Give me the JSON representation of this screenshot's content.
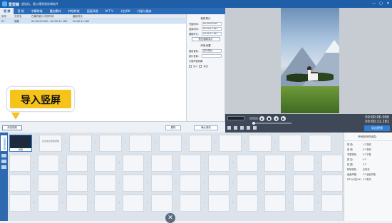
{
  "titlebar": {
    "app_name": "爱剪辑",
    "subtitle": "超轻松，最火爆视频剪辑软件",
    "buttons": [
      "—",
      "▢",
      "✕"
    ]
  },
  "menu": {
    "items": [
      "视 频",
      "音 频",
      "字幕特效",
      "叠加素材",
      "转场特效",
      "画面风格",
      "M T V",
      "卡拉OK",
      "升级与服务"
    ],
    "active_index": 0
  },
  "table": {
    "columns": [
      "序号",
      "文件名",
      "在最终影片中的时间",
      "截取时长"
    ],
    "rows": [
      {
        "index": "01",
        "name": "视频",
        "range": "00:00:00.000 - 00:00:11.181",
        "duration": "00:00:11.181"
      }
    ]
  },
  "props": {
    "group1_title": "裁剪原片",
    "start_label": "开始时间:",
    "start_value": "00:00:00.000",
    "end_label": "结束时间:",
    "end_value": "00:00:11.181",
    "dur_label": "截取时长:",
    "dur_value": "00:00:11.181",
    "preview_btn": "预览/截取原片",
    "group2_title": "声音设置",
    "track_label": "使用音轨:",
    "track_value": "原片音轨1",
    "volume_label": "原片音量:",
    "headtail_label": "头尾声音效果:",
    "fadein": "淡入",
    "fadeout": "淡出"
  },
  "actionbar": {
    "add_video": "添加视频",
    "delete": "删除",
    "confirm": "确认修改"
  },
  "callout": {
    "text": "导入竖屏"
  },
  "player": {
    "time_current": "00:00:00.000",
    "time_total": "00:00:11.181",
    "export": "导出视频"
  },
  "timeline": {
    "side_tab": "已添加片段",
    "first_clip_caption": "视频",
    "placeholder_text": "双击此处添加视频"
  },
  "rightpanel": {
    "title": "所有制作的信息：",
    "rows": [
      {
        "k": "视  频:",
        "v": "1个视频"
      },
      {
        "k": "音  频:",
        "v": "0个音频"
      },
      {
        "k": "字幕特效:",
        "v": "0个字幕"
      },
      {
        "k": "叠  加:",
        "v": "0个"
      },
      {
        "k": "贴  图:",
        "v": "0个"
      },
      {
        "k": "转场特效:",
        "v": "无特效"
      },
      {
        "k": "画面风格:",
        "v": "0个画面风格"
      },
      {
        "k": "MTV/卡拉OK:",
        "v": "0个歌词"
      }
    ]
  },
  "colors": {
    "brand": "#1f5fa8",
    "accent": "#2e7fd6",
    "callout": "#f6c31a"
  }
}
